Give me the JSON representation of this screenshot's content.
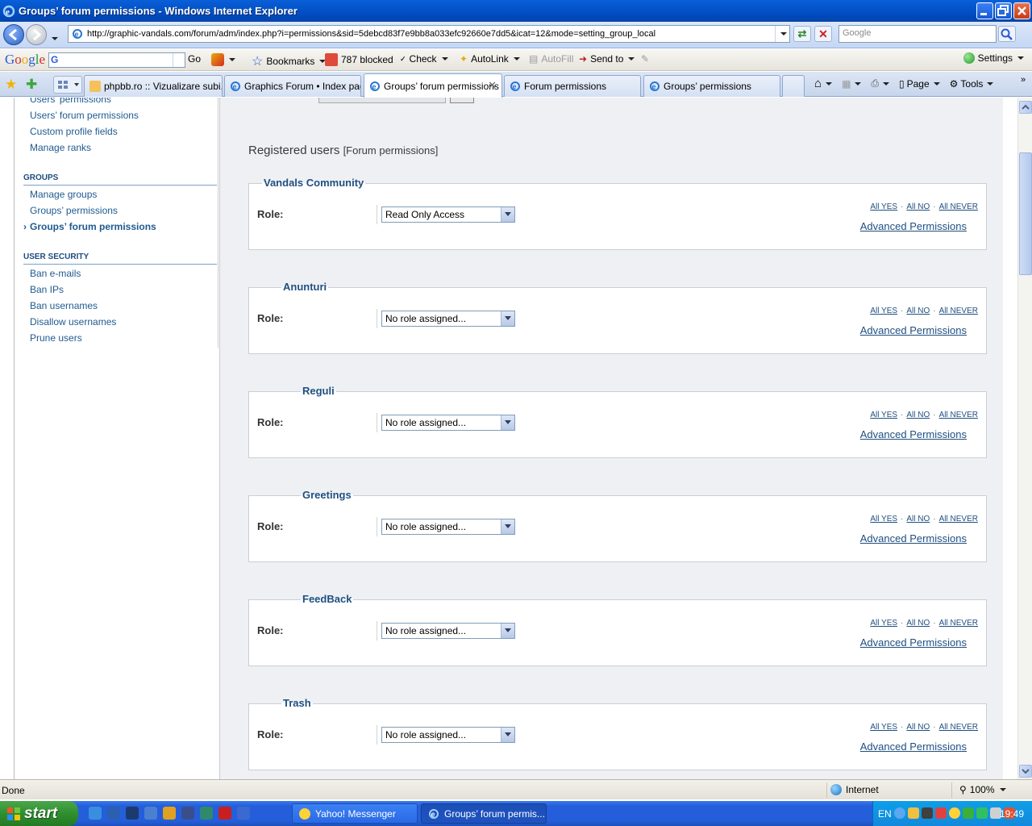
{
  "window": {
    "title": "Groups’ forum permissions - Windows Internet Explorer"
  },
  "address": {
    "url": "http://graphic-vandals.com/forum/adm/index.php?i=permissions&sid=5debcd83f7e9bb8a033efc92660e7dd5&icat=12&mode=setting_group_local",
    "search_placeholder": "Google"
  },
  "google_toolbar": {
    "logo": [
      "G",
      "o",
      "o",
      "g",
      "l",
      "e"
    ],
    "search_prefix": "G",
    "go_label": "Go",
    "bookmarks_label": "Bookmarks",
    "blocked_label": "787 blocked",
    "check_label": "Check",
    "autolink_label": "AutoLink",
    "autofill_label": "AutoFill",
    "sendto_label": "Send to",
    "settings_label": "Settings"
  },
  "tabs": [
    {
      "label": "phpbb.ro :: Vizualizare subi..."
    },
    {
      "label": "Graphics Forum • Index page"
    },
    {
      "label": "Groups’ forum permissions"
    },
    {
      "label": "Forum permissions"
    },
    {
      "label": "Groups’ permissions"
    }
  ],
  "command_bar": {
    "page_label": "Page",
    "tools_label": "Tools"
  },
  "sidebar": {
    "partial_item": "Users’ permissions",
    "items_top": [
      {
        "label": "Users’ forum permissions"
      },
      {
        "label": "Custom profile fields"
      },
      {
        "label": "Manage ranks"
      }
    ],
    "groups_heading": "GROUPS",
    "groups_items": [
      {
        "label": "Manage groups"
      },
      {
        "label": "Groups’ permissions"
      },
      {
        "label": "Groups’ forum permissions"
      }
    ],
    "security_heading": "USER SECURITY",
    "security_items": [
      {
        "label": "Ban e-mails"
      },
      {
        "label": "Ban IPs"
      },
      {
        "label": "Ban usernames"
      },
      {
        "label": "Disallow usernames"
      },
      {
        "label": "Prune users"
      }
    ]
  },
  "main": {
    "heading": "Registered users",
    "heading_sub": "[Forum permissions]",
    "role_label": "Role:",
    "all_yes": "All YES",
    "all_no": "All NO",
    "all_never": "All NEVER",
    "separator": "·",
    "advanced_label": "Advanced Permissions",
    "forums": [
      {
        "name": "Vandals Community",
        "role": "Read Only Access"
      },
      {
        "name": "Anunturi",
        "role": "No role assigned..."
      },
      {
        "name": "Reguli",
        "role": "No role assigned..."
      },
      {
        "name": "Greetings",
        "role": "No role assigned..."
      },
      {
        "name": "FeedBack",
        "role": "No role assigned..."
      },
      {
        "name": "Trash",
        "role": "No role assigned..."
      }
    ]
  },
  "status": {
    "text": "Done",
    "zone": "Internet",
    "zoom": "100%"
  },
  "taskbar": {
    "start_label": "start",
    "tasks": [
      {
        "label": "Yahoo! Messenger"
      },
      {
        "label": "Groups’ forum permis..."
      }
    ],
    "lang": "EN",
    "clock": "19:49"
  }
}
